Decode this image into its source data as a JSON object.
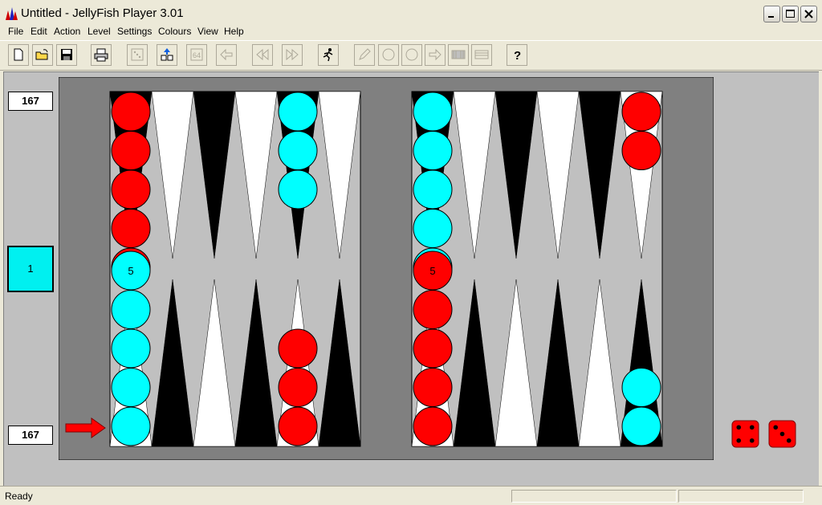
{
  "window": {
    "title": "Untitled - JellyFish Player 3.01"
  },
  "menu": [
    "File",
    "Edit",
    "Action",
    "Level",
    "Settings",
    "Colours",
    "View",
    "Help"
  ],
  "toolbar": {
    "buttons": [
      "new-doc",
      "open-folder",
      "save",
      "print",
      "dice",
      "cube-up",
      "cube-64",
      "back-arrow",
      "rewind",
      "fast-forward",
      "run-man",
      "pencil",
      "circle",
      "circle",
      "next-arrow",
      "board-dark",
      "board-light",
      "help"
    ]
  },
  "scores": {
    "top": "167",
    "bottom": "167"
  },
  "cube": {
    "value": "1"
  },
  "board": {
    "colors": {
      "frame": "#808080",
      "felt": "#c0c0c0",
      "dark_point": "#000000",
      "light_point": "#ffffff",
      "red": "#ff0000",
      "cyan": "#00ffff"
    },
    "stacks": [
      {
        "half": "left",
        "pos": 0,
        "side": "top",
        "color": "red",
        "count": 5,
        "label": "5"
      },
      {
        "half": "left",
        "pos": 4,
        "side": "top",
        "color": "cyan",
        "count": 3,
        "label": ""
      },
      {
        "half": "left",
        "pos": 0,
        "side": "bottom",
        "color": "cyan",
        "count": 5,
        "label": "5"
      },
      {
        "half": "left",
        "pos": 4,
        "side": "bottom",
        "color": "red",
        "count": 3,
        "label": ""
      },
      {
        "half": "right",
        "pos": 0,
        "side": "top",
        "color": "cyan",
        "count": 5,
        "label": "5"
      },
      {
        "half": "right",
        "pos": 5,
        "side": "top",
        "color": "red",
        "count": 2,
        "label": ""
      },
      {
        "half": "right",
        "pos": 0,
        "side": "bottom",
        "color": "red",
        "count": 5,
        "label": "5"
      },
      {
        "half": "right",
        "pos": 5,
        "side": "bottom",
        "color": "cyan",
        "count": 2,
        "label": ""
      }
    ]
  },
  "dice": [
    4,
    3
  ],
  "dice_color": "#ff0000",
  "turn_indicator": "red-arrow",
  "status": {
    "text": "Ready"
  }
}
